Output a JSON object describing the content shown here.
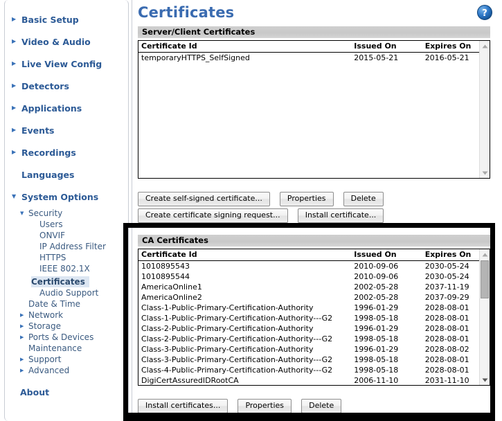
{
  "sidebar": {
    "items": [
      {
        "label": "Basic Setup",
        "level": 0,
        "arrow": "right",
        "selected": false
      },
      {
        "label": "Video & Audio",
        "level": 0,
        "arrow": "right",
        "selected": false
      },
      {
        "label": "Live View Config",
        "level": 0,
        "arrow": "right",
        "selected": false
      },
      {
        "label": "Detectors",
        "level": 0,
        "arrow": "right",
        "selected": false
      },
      {
        "label": "Applications",
        "level": 0,
        "arrow": "right",
        "selected": false
      },
      {
        "label": "Events",
        "level": 0,
        "arrow": "right",
        "selected": false
      },
      {
        "label": "Recordings",
        "level": 0,
        "arrow": "right",
        "selected": false
      },
      {
        "label": "Languages",
        "level": 0,
        "arrow": "none",
        "selected": false
      },
      {
        "label": "System Options",
        "level": 0,
        "arrow": "down",
        "selected": false
      }
    ],
    "subitems": [
      {
        "label": "Security",
        "level": 2,
        "arrow": "down",
        "selected": false
      },
      {
        "label": "Users",
        "level": 3,
        "arrow": "none",
        "selected": false
      },
      {
        "label": "ONVIF",
        "level": 3,
        "arrow": "none",
        "selected": false
      },
      {
        "label": "IP Address Filter",
        "level": 3,
        "arrow": "none",
        "selected": false
      },
      {
        "label": "HTTPS",
        "level": 3,
        "arrow": "none",
        "selected": false
      },
      {
        "label": "IEEE 802.1X",
        "level": 3,
        "arrow": "none",
        "selected": false
      },
      {
        "label": "Certificates",
        "level": 3,
        "arrow": "none",
        "selected": true
      },
      {
        "label": "Audio Support",
        "level": 3,
        "arrow": "none",
        "selected": false
      },
      {
        "label": "Date & Time",
        "level": 2,
        "arrow": "none",
        "selected": false
      },
      {
        "label": "Network",
        "level": 2,
        "arrow": "right",
        "selected": false
      },
      {
        "label": "Storage",
        "level": 2,
        "arrow": "right",
        "selected": false
      },
      {
        "label": "Ports & Devices",
        "level": 2,
        "arrow": "right",
        "selected": false
      },
      {
        "label": "Maintenance",
        "level": 2,
        "arrow": "none",
        "selected": false
      },
      {
        "label": "Support",
        "level": 2,
        "arrow": "right",
        "selected": false
      },
      {
        "label": "Advanced",
        "level": 2,
        "arrow": "right",
        "selected": false
      }
    ],
    "about_label": "About"
  },
  "header": {
    "title": "Certificates",
    "help_icon": "help-circle-icon"
  },
  "server_section": {
    "heading": "Server/Client Certificates",
    "columns": [
      "Certificate Id",
      "Issued On",
      "Expires On"
    ],
    "rows": [
      [
        "temporaryHTTPS_SelfSigned",
        "2015-05-21",
        "2016-05-21"
      ]
    ],
    "buttons_row1": [
      "Create self-signed certificate...",
      "Properties",
      "Delete"
    ],
    "buttons_row2": [
      "Create certificate signing request...",
      "Install certificate..."
    ]
  },
  "ca_section": {
    "heading": "CA Certificates",
    "columns": [
      "Certificate Id",
      "Issued On",
      "Expires On"
    ],
    "rows": [
      [
        "1010895543",
        "2010-09-06",
        "2030-05-24"
      ],
      [
        "1010895544",
        "2010-09-06",
        "2030-05-24"
      ],
      [
        "AmericaOnline1",
        "2002-05-28",
        "2037-11-19"
      ],
      [
        "AmericaOnline2",
        "2002-05-28",
        "2037-09-29"
      ],
      [
        "Class-1-Public-Primary-Certification-Authority",
        "1996-01-29",
        "2028-08-01"
      ],
      [
        "Class-1-Public-Primary-Certification-Authority---G2",
        "1998-05-18",
        "2028-08-01"
      ],
      [
        "Class-2-Public-Primary-Certification-Authority",
        "1996-01-29",
        "2028-08-01"
      ],
      [
        "Class-2-Public-Primary-Certification-Authority---G2",
        "1998-05-18",
        "2028-08-01"
      ],
      [
        "Class-3-Public-Primary-Certification-Authority",
        "1996-01-29",
        "2028-08-02"
      ],
      [
        "Class-3-Public-Primary-Certification-Authority---G2",
        "1998-05-18",
        "2028-08-01"
      ],
      [
        "Class-4-Public-Primary-Certification-Authority---G2",
        "1998-05-18",
        "2028-08-01"
      ],
      [
        "DigiCertAssuredIDRootCA",
        "2006-11-10",
        "2031-11-10"
      ]
    ],
    "buttons": [
      "Install certificates...",
      "Properties",
      "Delete"
    ]
  },
  "colors": {
    "accent": "#3a6bb0",
    "sidebar_link": "#2c5a96",
    "selection_bg": "#dce6f2",
    "section_header_bg": "#cfcfcf",
    "highlight_frame": "#000000"
  }
}
